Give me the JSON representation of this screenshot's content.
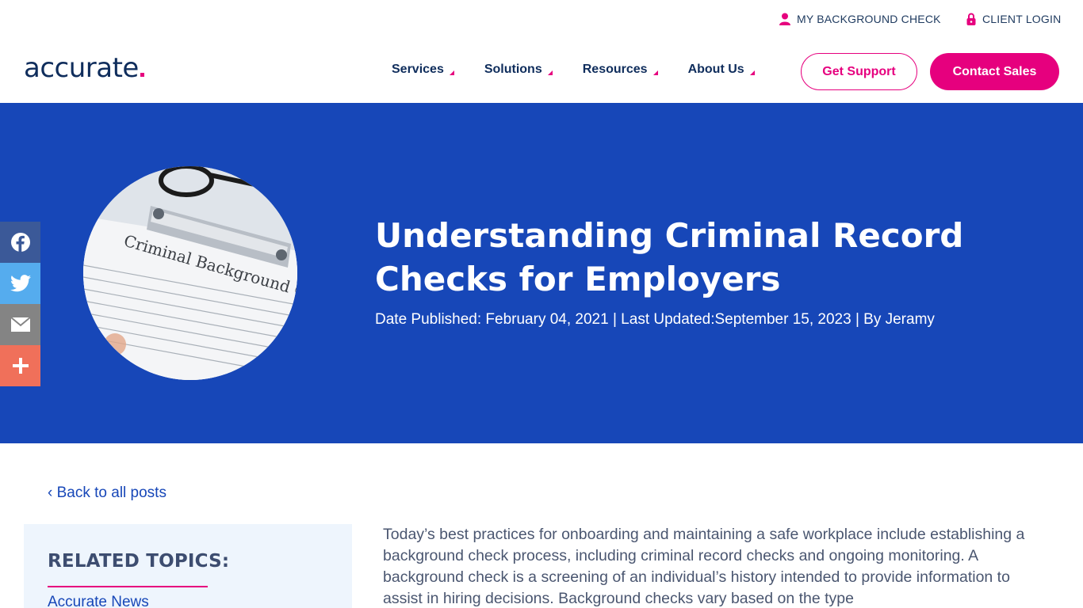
{
  "utility": {
    "my_background_check": "MY BACKGROUND CHECK",
    "client_login": "CLIENT LOGIN"
  },
  "header": {
    "logo_text": "accurate",
    "nav": [
      {
        "label": "Services"
      },
      {
        "label": "Solutions"
      },
      {
        "label": "Resources"
      },
      {
        "label": "About Us"
      }
    ],
    "get_support": "Get Support",
    "contact_sales": "Contact Sales"
  },
  "hero": {
    "title": "Understanding Criminal Record Checks for Employers",
    "meta": "Date Published: February 04, 2021 | Last Updated:September 15, 2023 | By Jeramy",
    "image_text": "Criminal Background Che"
  },
  "share": {
    "icons": [
      "facebook-icon",
      "twitter-icon",
      "email-icon",
      "plus-icon"
    ]
  },
  "content": {
    "back_link": "‹ Back to all posts",
    "related_title": "RELATED TOPICS:",
    "related_link": "Accurate News",
    "body": "Today’s best practices for onboarding and maintaining a safe workplace include establishing a background check process, including criminal record checks and ongoing monitoring. A background check is a screening of an individual’s history intended to provide information to assist in hiring decisions. Background checks vary based on the type"
  },
  "colors": {
    "brand_blue": "#1747b8",
    "brand_navy": "#0f2d5c",
    "brand_pink": "#e6007e"
  }
}
